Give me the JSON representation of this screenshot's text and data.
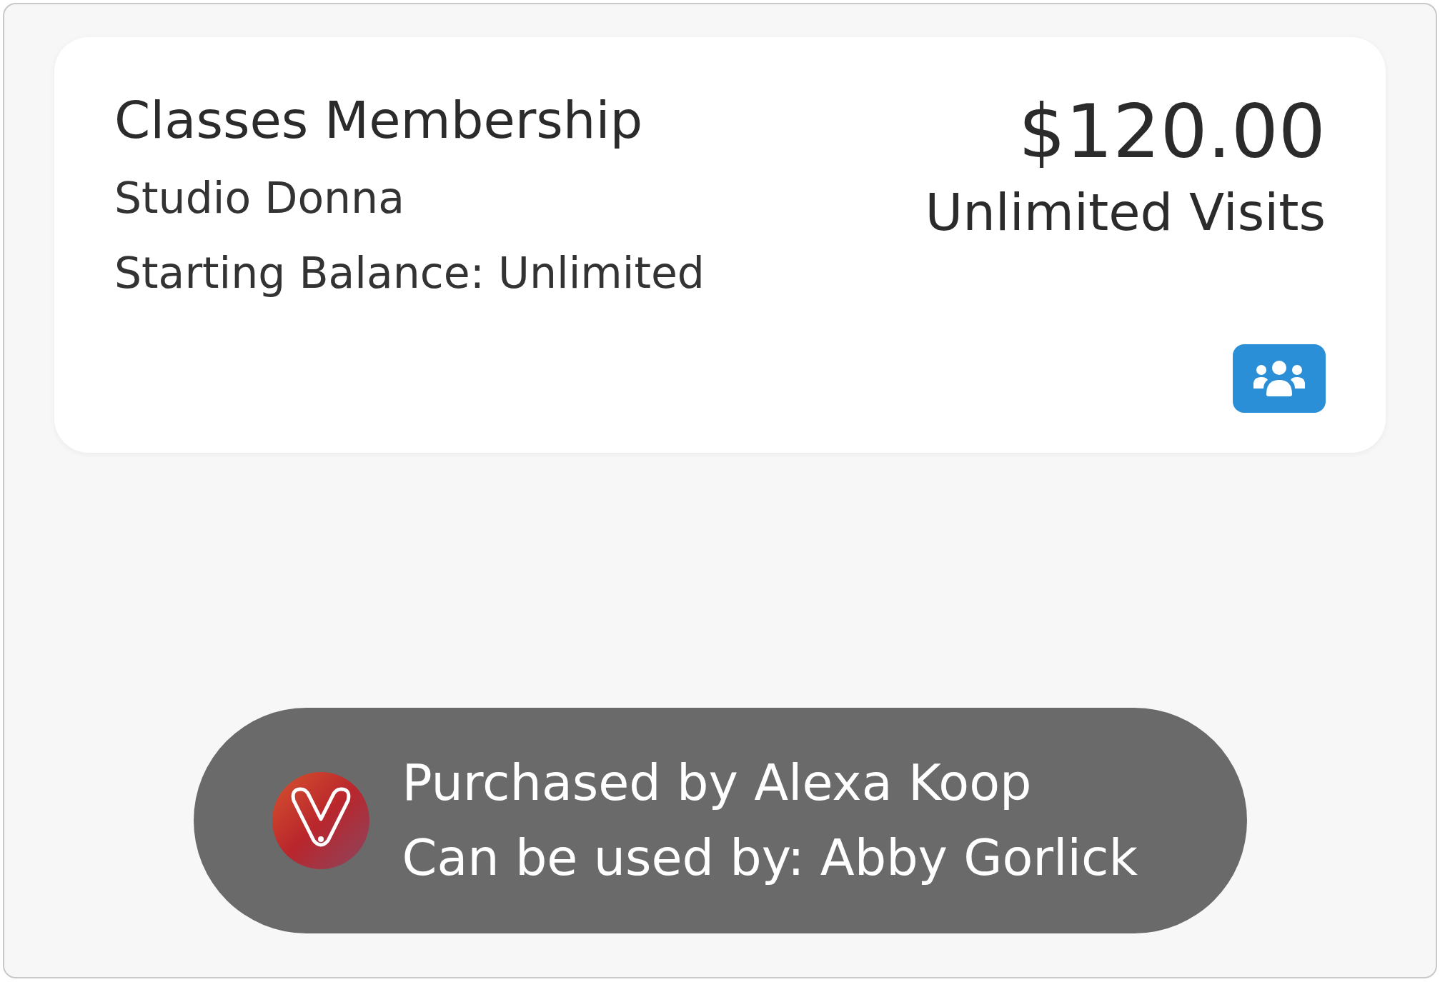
{
  "card": {
    "title": "Classes Membership",
    "studio": "Studio Donna",
    "balance": "Starting Balance: Unlimited",
    "price": "$120.00",
    "visits": "Unlimited Visits",
    "shared": true
  },
  "toast": {
    "lines": [
      "Purchased by Alexa Koop",
      "Can be used by: Abby Gorlick"
    ]
  }
}
